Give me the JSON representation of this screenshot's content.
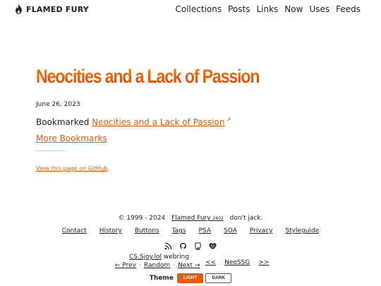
{
  "site": {
    "name": "FLAMED FURY",
    "logo_icon": "flame-icon"
  },
  "nav": [
    "Collections",
    "Posts",
    "Links",
    "Now",
    "Uses",
    "Feeds"
  ],
  "post": {
    "title": "Neocities and a Lack of Passion",
    "date": "June 26, 2023",
    "bookmark_prefix": "Bookmarked",
    "bookmark_link": "Neocities and a Lack of Passion",
    "bookmark_ext_icon": "↗",
    "more_label": "More Bookmarks",
    "github_label": "View this page on GitHub",
    "github_suffix": "."
  },
  "footer": {
    "copyright_years": "© 1999 - 2024",
    "copyright_name": "Flamed Fury",
    "version": "2402",
    "tagline": "don't jack.",
    "links": [
      "Contact",
      "History",
      "Buttons",
      "Tags",
      "PSA",
      "SOA",
      "Privacy",
      "Styleguide"
    ],
    "social_icons": [
      "rss-icon",
      "github-icon",
      "mastodon-icon",
      "heart-face-icon"
    ],
    "webring": {
      "title_link": "CS.Sjoy.lol",
      "title_suffix": "webring",
      "prev": "← Prev",
      "random": "Random",
      "next": "Next →",
      "ssg_prev": "<<",
      "ssg_name": "NeoSSG",
      "ssg_next": ">>"
    },
    "theme": {
      "label": "Theme",
      "light": "LIGHT",
      "dark": "DARK"
    }
  },
  "colors": {
    "accent": "#e8590c",
    "text": "#222222",
    "background": "#ffffff"
  }
}
